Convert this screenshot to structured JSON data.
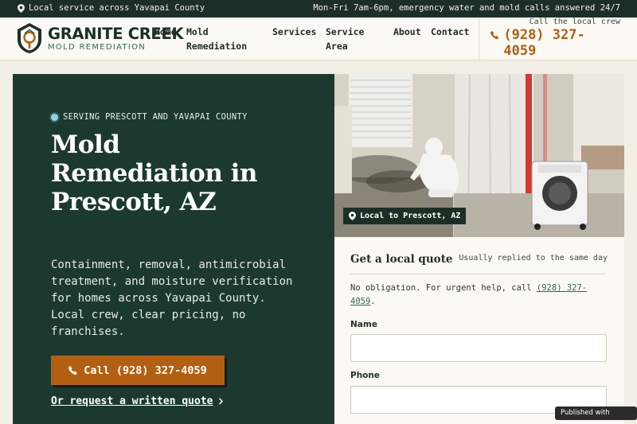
{
  "topbar": {
    "location_icon": "map-pin-icon",
    "service_area": "Local service across Yavapai County",
    "hours": "Mon-Fri 7am-6pm, emergency water and mold calls answered 24/7"
  },
  "brand": {
    "name": "GRANITE CREEK",
    "tagline": "MOLD REMEDIATION",
    "badge_icon": "house-shield-logo-icon"
  },
  "nav": {
    "home": "Home",
    "mold_line1": "Mold",
    "mold_line2": "Remediation",
    "services": "Services",
    "area_line1": "Service",
    "area_line2": "Area",
    "about": "About",
    "contact": "Contact"
  },
  "header_call": {
    "label": "Call the local crew",
    "phone": "(928) 327-4059",
    "icon": "phone-icon"
  },
  "hero": {
    "eyebrow": "SERVING PRESCOTT AND YAVAPAI COUNTY",
    "title": "Mold Remediation in Prescott, AZ",
    "description": "Containment, removal, antimicrobial treatment, and moisture verification for homes across Yavapai County. Local crew, clear pricing, no franchises.",
    "cta_label": "Call (928) 327-4059",
    "quote_link": "Or request a written quote"
  },
  "photo": {
    "badge": "Local to Prescott, AZ"
  },
  "quote": {
    "title": "Get a local quote",
    "reply_time": "Usually replied to the same day",
    "note_prefix": "No obligation. For urgent help, call ",
    "note_phone": "(928) 327-4059",
    "note_suffix": ".",
    "name_label": "Name",
    "phone_label": "Phone"
  },
  "footer_badge": {
    "label": "Published with shiply →"
  },
  "colors": {
    "dark_green": "#1c2f27",
    "hero_green": "#1c3930",
    "accent_orange": "#b25f12",
    "cream": "#f3efe6"
  }
}
